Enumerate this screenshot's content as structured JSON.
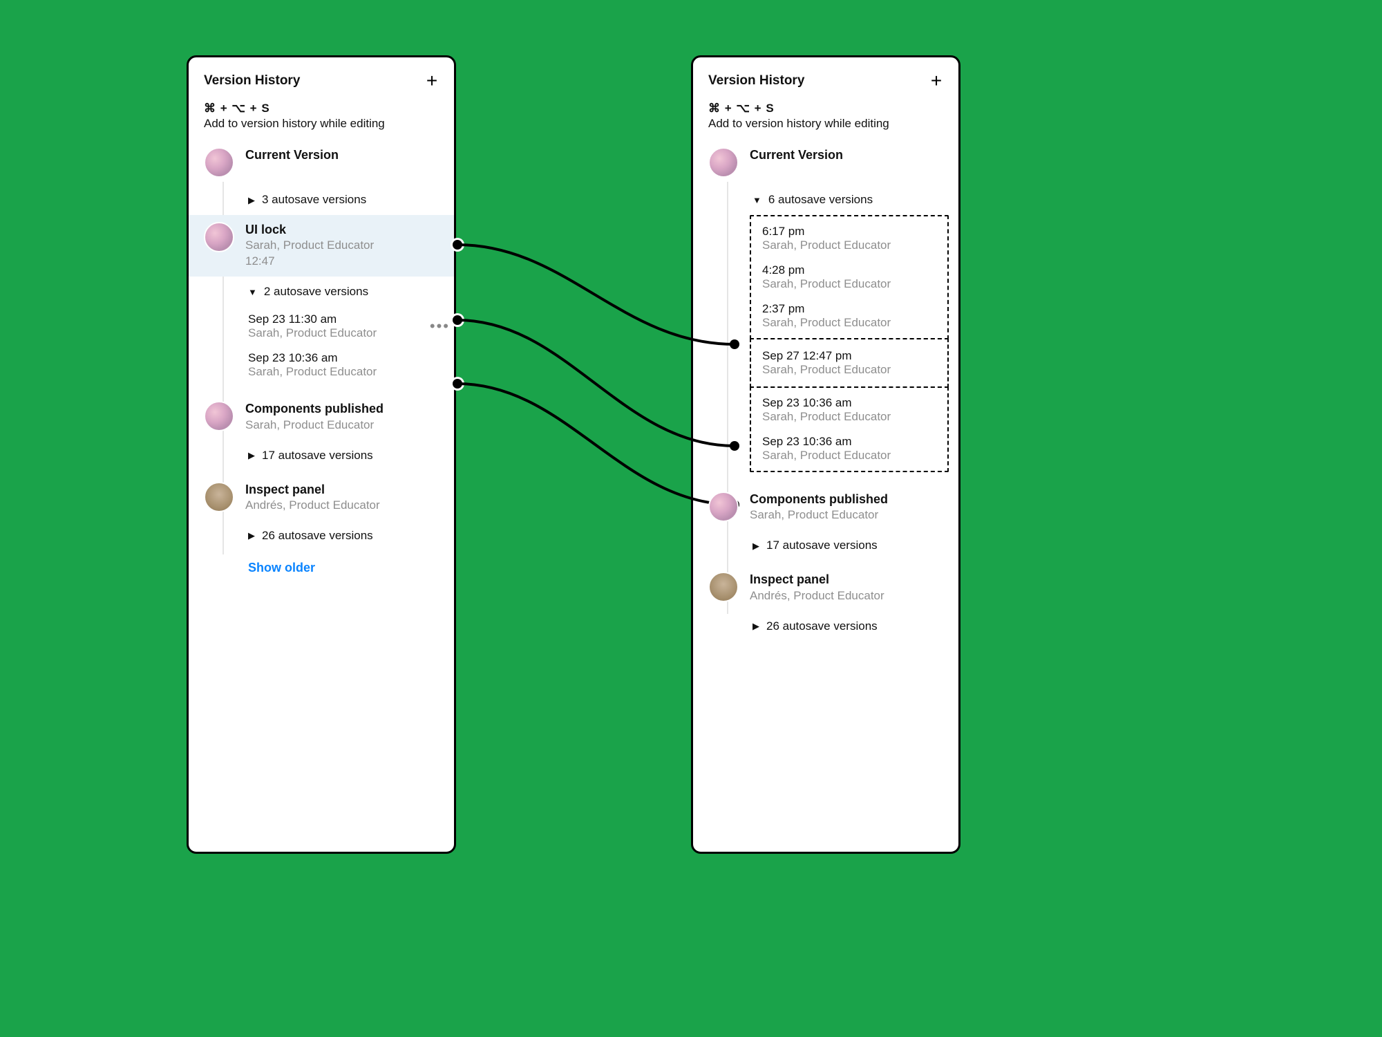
{
  "header": {
    "title": "Version History",
    "shortcut": "⌘ + ⌥ + S",
    "shortcut_desc": "Add to version history while editing"
  },
  "left": {
    "current_label": "Current Version",
    "current_autosave": "3 autosave versions",
    "ui_lock": {
      "title": "UI lock",
      "author": "Sarah, Product Educator",
      "time": "12:47",
      "autosave": "2 autosave versions",
      "items": [
        {
          "time": "Sep 23 11:30 am",
          "author": "Sarah, Product Educator"
        },
        {
          "time": "Sep 23 10:36 am",
          "author": "Sarah, Product Educator"
        }
      ]
    },
    "components": {
      "title": "Components published",
      "author": "Sarah, Product Educator",
      "autosave": "17 autosave versions"
    },
    "inspect": {
      "title": "Inspect panel",
      "author": "Andrés, Product Educator",
      "autosave": "26 autosave versions"
    },
    "show_older": "Show older"
  },
  "right": {
    "current_label": "Current Version",
    "current_autosave": "6 autosave versions",
    "top_group": [
      {
        "time": "6:17 pm",
        "author": "Sarah, Product Educator"
      },
      {
        "time": "4:28 pm",
        "author": "Sarah, Product Educator"
      },
      {
        "time": "2:37 pm",
        "author": "Sarah, Product Educator"
      }
    ],
    "middle": {
      "time": "Sep 27 12:47 pm",
      "author": "Sarah, Product Educator"
    },
    "bottom_group": [
      {
        "time": "Sep 23 10:36 am",
        "author": "Sarah, Product Educator"
      },
      {
        "time": "Sep 23 10:36 am",
        "author": "Sarah, Product Educator"
      }
    ],
    "components": {
      "title": "Components published",
      "author": "Sarah, Product Educator",
      "autosave": "17 autosave versions"
    },
    "inspect": {
      "title": "Inspect panel",
      "author": "Andrés, Product Educator",
      "autosave": "26 autosave versions"
    }
  }
}
